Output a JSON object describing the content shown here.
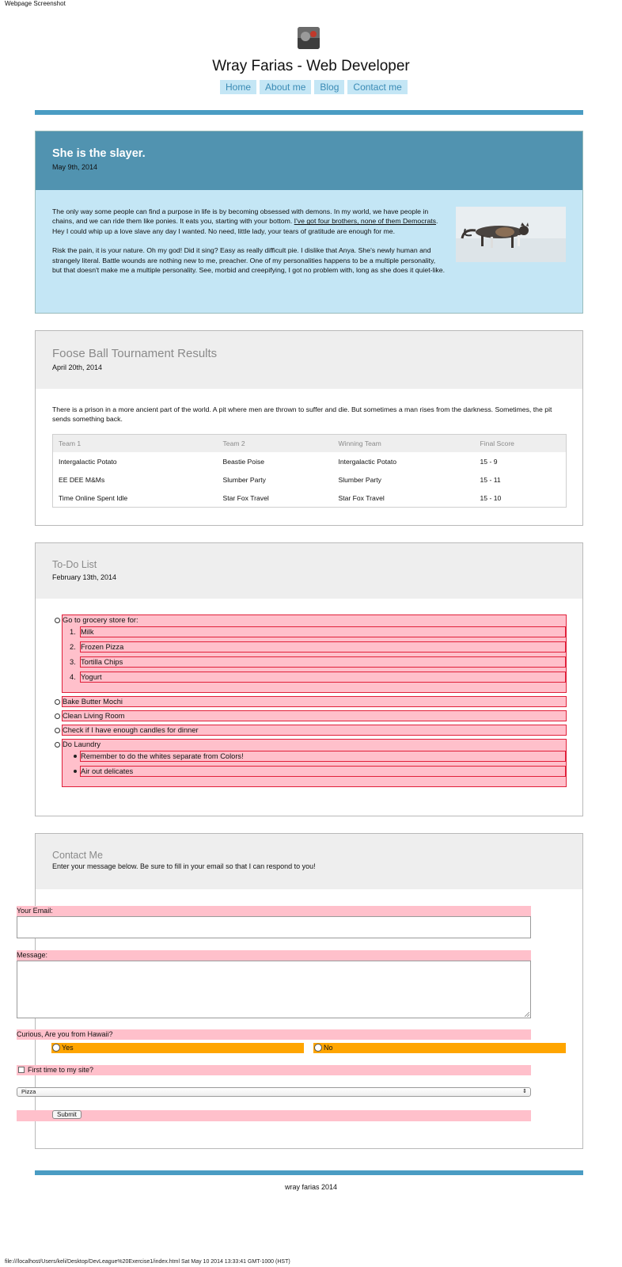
{
  "capture": {
    "title": "Webpage Screenshot",
    "footer": "file:///localhost/Users/keli/Desktop/DevLeague%20Exercise1/index.html Sat May 10 2014 13:33:41 GMT-1000 (HST)"
  },
  "header": {
    "title": "Wray Farias - Web Developer",
    "nav": [
      "Home",
      "About me",
      "Blog",
      "Contact me"
    ]
  },
  "posts": [
    {
      "title": "She is the slayer.",
      "date": "May 9th, 2014",
      "p1_a": "The only way some people can find a purpose in life is by becoming obsessed with demons. In my world, we have people in chains, and we can ride them like ponies. It eats you, starting with your bottom. ",
      "p1_link": "I've got four brothers, none of them Democrats",
      "p1_b": ". Hey I could whip up a love slave any day I wanted. No need, little lady, your tears of gratitude are enough for me.",
      "p2": "Risk the pain, it is your nature. Oh my god! Did it sing? Easy as really difficult pie. I dislike that Anya. She's newly human and strangely literal. Battle wounds are nothing new to me, preacher. One of my personalities happens to be a multiple personality, but that doesn't make me a multiple personality. See, morbid and creepifying, I got no problem with, long as she does it quiet-like."
    },
    {
      "title": "Foose Ball Tournament Results",
      "date": "April 20th, 2014",
      "text": "There is a prison in a more ancient part of the world. A pit where men are thrown to suffer and die. But sometimes a man rises from the darkness. Sometimes, the pit sends something back.",
      "table": {
        "headers": [
          "Team 1",
          "Team 2",
          "Winning Team",
          "Final Score"
        ],
        "rows": [
          [
            "Intergalactic Potato",
            "Beastie Poise",
            "Intergalactic Potato",
            "15 - 9"
          ],
          [
            "EE DEE M&Ms",
            "Slumber Party",
            "Slumber Party",
            "15 - 11"
          ],
          [
            "Time Online Spent Idle",
            "Star Fox Travel",
            "Star Fox Travel",
            "15 - 10"
          ]
        ]
      }
    },
    {
      "title": "To-Do List",
      "date": "February 13th, 2014",
      "grocery": "Go to grocery store for:",
      "grocery_items": [
        "Milk",
        "Frozen Pizza",
        "Tortilla Chips",
        "Yogurt"
      ],
      "grocery_nums": [
        "1.",
        "2.",
        "3.",
        "4."
      ],
      "mochi": "Bake Butter Mochi",
      "living": "Clean Living Room",
      "candles": "Check if I have enough candles for dinner",
      "laundry": "Do Laundry",
      "laundry_items": [
        "Remember to do the whites separate from Colors!",
        "Air out delicates"
      ]
    }
  ],
  "contact": {
    "title": "Contact Me",
    "subtitle": "Enter your message below. Be sure to fill in your email so that I can respond to you!",
    "email_label": "Your Email:",
    "message_label": "Message:",
    "hawaii_label": "Curious, Are you from Hawaii?",
    "yes": "Yes",
    "no": "No",
    "first_time": "First time to my site?",
    "select_value": "Pizza",
    "submit": "Submit"
  },
  "footer": {
    "text": "wray farias 2014"
  },
  "colors": {
    "accent": "#4a9cc3",
    "post_header": "#5193b0",
    "post_body": "#c4e6f5",
    "highlight": "#ffc0cb",
    "radio_highlight": "#ffa500"
  }
}
